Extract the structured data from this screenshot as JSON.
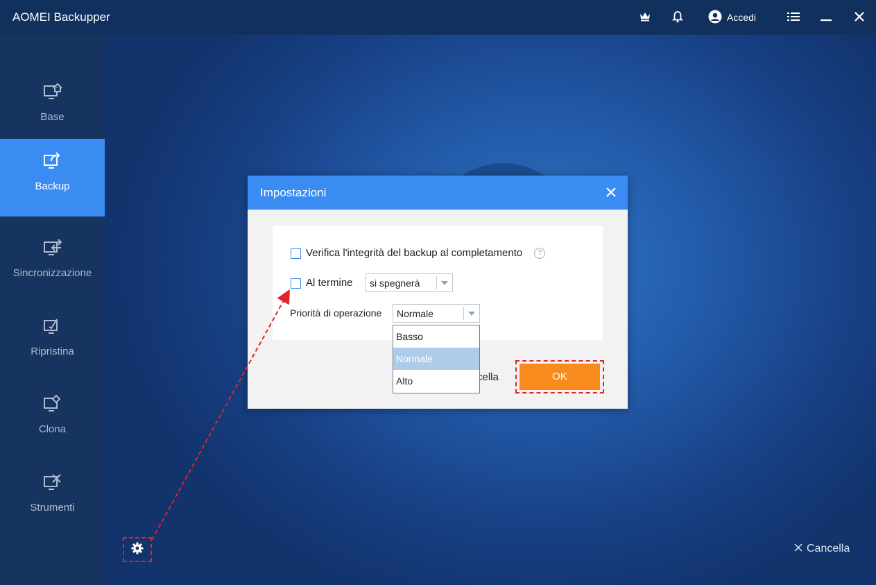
{
  "app": {
    "title": "AOMEI Backupper"
  },
  "titlebar": {
    "icons": [
      "crown-icon",
      "bell-icon",
      "user-icon",
      "menu-icon",
      "minimize-icon",
      "close-icon"
    ],
    "login_label": "Accedi"
  },
  "sidebar": {
    "items": [
      {
        "label": "Base",
        "icon": "home-monitor-icon",
        "active": false
      },
      {
        "label": "Backup",
        "icon": "backup-monitor-icon",
        "active": true
      },
      {
        "label": "Sincronizzazione",
        "icon": "sync-monitor-icon",
        "active": false
      },
      {
        "label": "Ripristina",
        "icon": "restore-monitor-icon",
        "active": false
      },
      {
        "label": "Clona",
        "icon": "clone-monitor-icon",
        "active": false
      },
      {
        "label": "Strumenti",
        "icon": "tools-monitor-icon",
        "active": false
      }
    ],
    "settings_icon": "gear-icon"
  },
  "main": {
    "cancel_label": "Cancella"
  },
  "dialog": {
    "title": "Impostazioni",
    "verify_label": "Verifica l'integrità del backup al completamento",
    "verify_checked": false,
    "on_complete_label": "Al termine",
    "on_complete_checked": false,
    "on_complete_value": "si spegnerà",
    "priority_label": "Priorità di operazione",
    "priority_value": "Normale",
    "priority_options": [
      "Basso",
      "Normale",
      "Alto"
    ],
    "priority_highlighted": "Normale",
    "cancel_partial": "cella",
    "ok_label": "OK"
  },
  "colors": {
    "accent": "#3b8cf2",
    "ok_button": "#f78b1e",
    "annotation": "#e0242a",
    "sidebar_bg": "#17335f"
  }
}
